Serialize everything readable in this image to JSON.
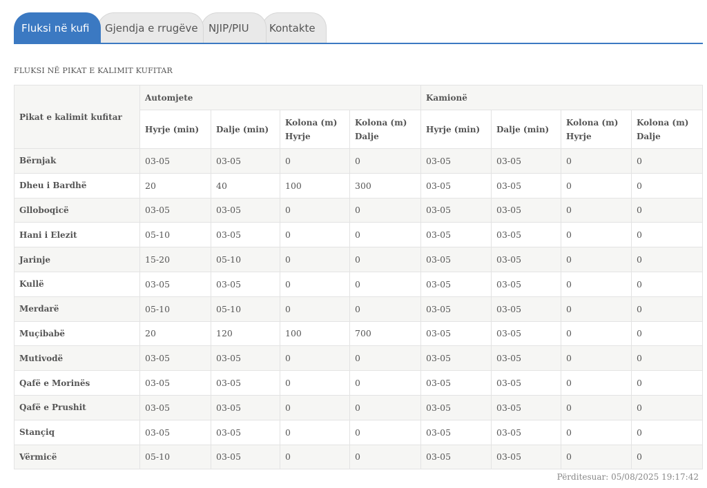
{
  "tabs": [
    "Fluksi në kufi",
    "Gjendja e rrugëve",
    "NJIP/PIU",
    "Kontakte"
  ],
  "section_title": "FLUKSI NË PIKAT E KALIMIT KUFITAR",
  "table": {
    "corner_label": "Pikat e kalimit kufitar",
    "group_labels": [
      "Automjete",
      "Kamionë"
    ],
    "sub_headers": [
      "Hyrje (min)",
      "Dalje (min)",
      "Kolona (m) Hyrje",
      "Kolona (m) Dalje",
      "Hyrje (min)",
      "Dalje (min)",
      "Kolona (m) Hyrje",
      "Kolona (m) Dalje"
    ],
    "rows": [
      [
        "Bërnjak",
        "03-05",
        "03-05",
        "0",
        "0",
        "03-05",
        "03-05",
        "0",
        "0"
      ],
      [
        "Dheu i Bardhë",
        "20",
        "40",
        "100",
        "300",
        "03-05",
        "03-05",
        "0",
        "0"
      ],
      [
        "Glloboqicë",
        "03-05",
        "03-05",
        "0",
        "0",
        "03-05",
        "03-05",
        "0",
        "0"
      ],
      [
        "Hani i Elezit",
        "05-10",
        "03-05",
        "0",
        "0",
        "03-05",
        "03-05",
        "0",
        "0"
      ],
      [
        "Jarinje",
        "15-20",
        "05-10",
        "0",
        "0",
        "03-05",
        "03-05",
        "0",
        "0"
      ],
      [
        "Kullë",
        "03-05",
        "03-05",
        "0",
        "0",
        "03-05",
        "03-05",
        "0",
        "0"
      ],
      [
        "Merdarë",
        "05-10",
        "05-10",
        "0",
        "0",
        "03-05",
        "03-05",
        "0",
        "0"
      ],
      [
        "Muçibabë",
        "20",
        "120",
        "100",
        "700",
        "03-05",
        "03-05",
        "0",
        "0"
      ],
      [
        "Mutivodë",
        "03-05",
        "03-05",
        "0",
        "0",
        "03-05",
        "03-05",
        "0",
        "0"
      ],
      [
        "Qafë e Morinës",
        "03-05",
        "03-05",
        "0",
        "0",
        "03-05",
        "03-05",
        "0",
        "0"
      ],
      [
        "Qafë e Prushit",
        "03-05",
        "03-05",
        "0",
        "0",
        "03-05",
        "03-05",
        "0",
        "0"
      ],
      [
        "Stançiq",
        "03-05",
        "03-05",
        "0",
        "0",
        "03-05",
        "03-05",
        "0",
        "0"
      ],
      [
        "Vërmicë",
        "05-10",
        "03-05",
        "0",
        "0",
        "03-05",
        "03-05",
        "0",
        "0"
      ]
    ]
  },
  "updated": "Përditesuar: 05/08/2025 19:17:42",
  "colors": {
    "accent": "#3b79c2",
    "tab_inactive": "#e9e9e9",
    "row_alt": "#f6f6f4"
  }
}
